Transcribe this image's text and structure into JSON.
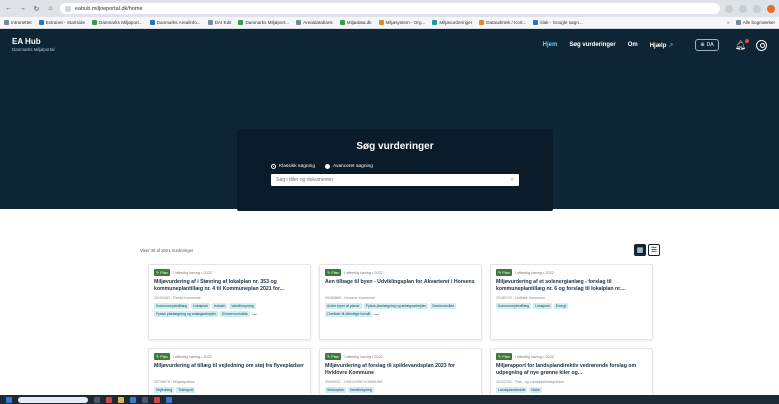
{
  "browser": {
    "url": "eahub.miljoeportal.dk/home",
    "bookmarks": [
      "Intranettet",
      "Extranet - Startside",
      "Danmarks Miljøport...",
      "Danmarks Arealinfo...",
      "DAI Edit",
      "Danmarks Miljøport...",
      "Arealdatabank",
      "Miljødata.dk",
      "Miljøsystem - Org...",
      "Miljøvurderinger",
      "Dataudtræk / Kort...",
      "klak - Google søgn..."
    ],
    "bookmarks_right": "Alle bogmærker"
  },
  "header": {
    "brand_title": "EA Hub",
    "brand_sub": "Danmarks Miljøportal",
    "nav": [
      "Hjem",
      "Søg vurderinger",
      "Om",
      "Hjælp"
    ],
    "lang": "DA"
  },
  "search": {
    "heading": "Søg vurderinger",
    "radio_classic": "Klassisk søgning",
    "radio_advanced": "Avanceret søgning",
    "placeholder": "Søg i titler og dokumenter"
  },
  "section": {
    "title": "Udforsk nyeste vurderinger",
    "count": "Viser 30 af 2921 Vurderinger"
  },
  "cards": [
    {
      "badge": "Plan",
      "meta": "I offentlig høring • 2022",
      "title": "Miljøvurdering af i Støvring af lokalplan nr. 353 og kommuneplantillæg nr. 4 til Kommuneplan 2021 for...",
      "sub": "29109463 - Rebild Kommune",
      "tags": [
        "Kommuneplantillæg",
        "Lokalplan",
        "Industri",
        "Vandforsyning",
        "Fysisk planlægning og anlægsarbejder",
        "Erhvervsområde"
      ]
    },
    {
      "badge": "Plan",
      "meta": "I offentlig høring • 2022",
      "title": "Åen tilbage til byen - Udviklingsplan for Åkvarteret i Horsens",
      "sub": "29189889 - Horsens Kommune",
      "tags": [
        "Andre typer af planer",
        "Fysisk planlægning og anlægsarbejder",
        "Centerområde",
        "Områder til offentlige formål"
      ]
    },
    {
      "badge": "Plan",
      "meta": "I offentlig høring • 2022",
      "title": "Miljøvurdering af et solenergianlæg - forslag til kommuneplantillæg nr. 6 og forslag til lokalplan nr....",
      "sub": "29189722 - Holbæk Kommune",
      "tags": [
        "Kommuneplantillæg",
        "Lokalplan",
        "Energi"
      ]
    },
    {
      "badge": "Plan",
      "meta": "I offentlig høring • 2022",
      "title": "Miljøvurdering af tillæg til vejledning om støj fra flyvepladser",
      "sub": "25798578 - Miljøstyrelsen",
      "tags": [
        "Vejledning",
        "Transport"
      ]
    },
    {
      "badge": "Plan",
      "meta": "I offentlig høring • 2022",
      "title": "Miljøvurdering af forslag til spildevandsplan 2023 for Hvidovre Kommune",
      "sub": "29409037 - HVIDOVRE KOMMUNE",
      "tags": [
        "Sektorplan",
        "Vandforsyning"
      ]
    },
    {
      "badge": "Plan",
      "meta": "I offentlig høring • 2022",
      "title": "Miljørapport for landsplandirektiv vedrørende forslag om udpegning af nye grønne kiler og...",
      "sub": "42122761 - Plan- og Landdistriktsstyrelsen",
      "tags": [
        "Landsplandirektiv",
        "Natur"
      ]
    }
  ]
}
